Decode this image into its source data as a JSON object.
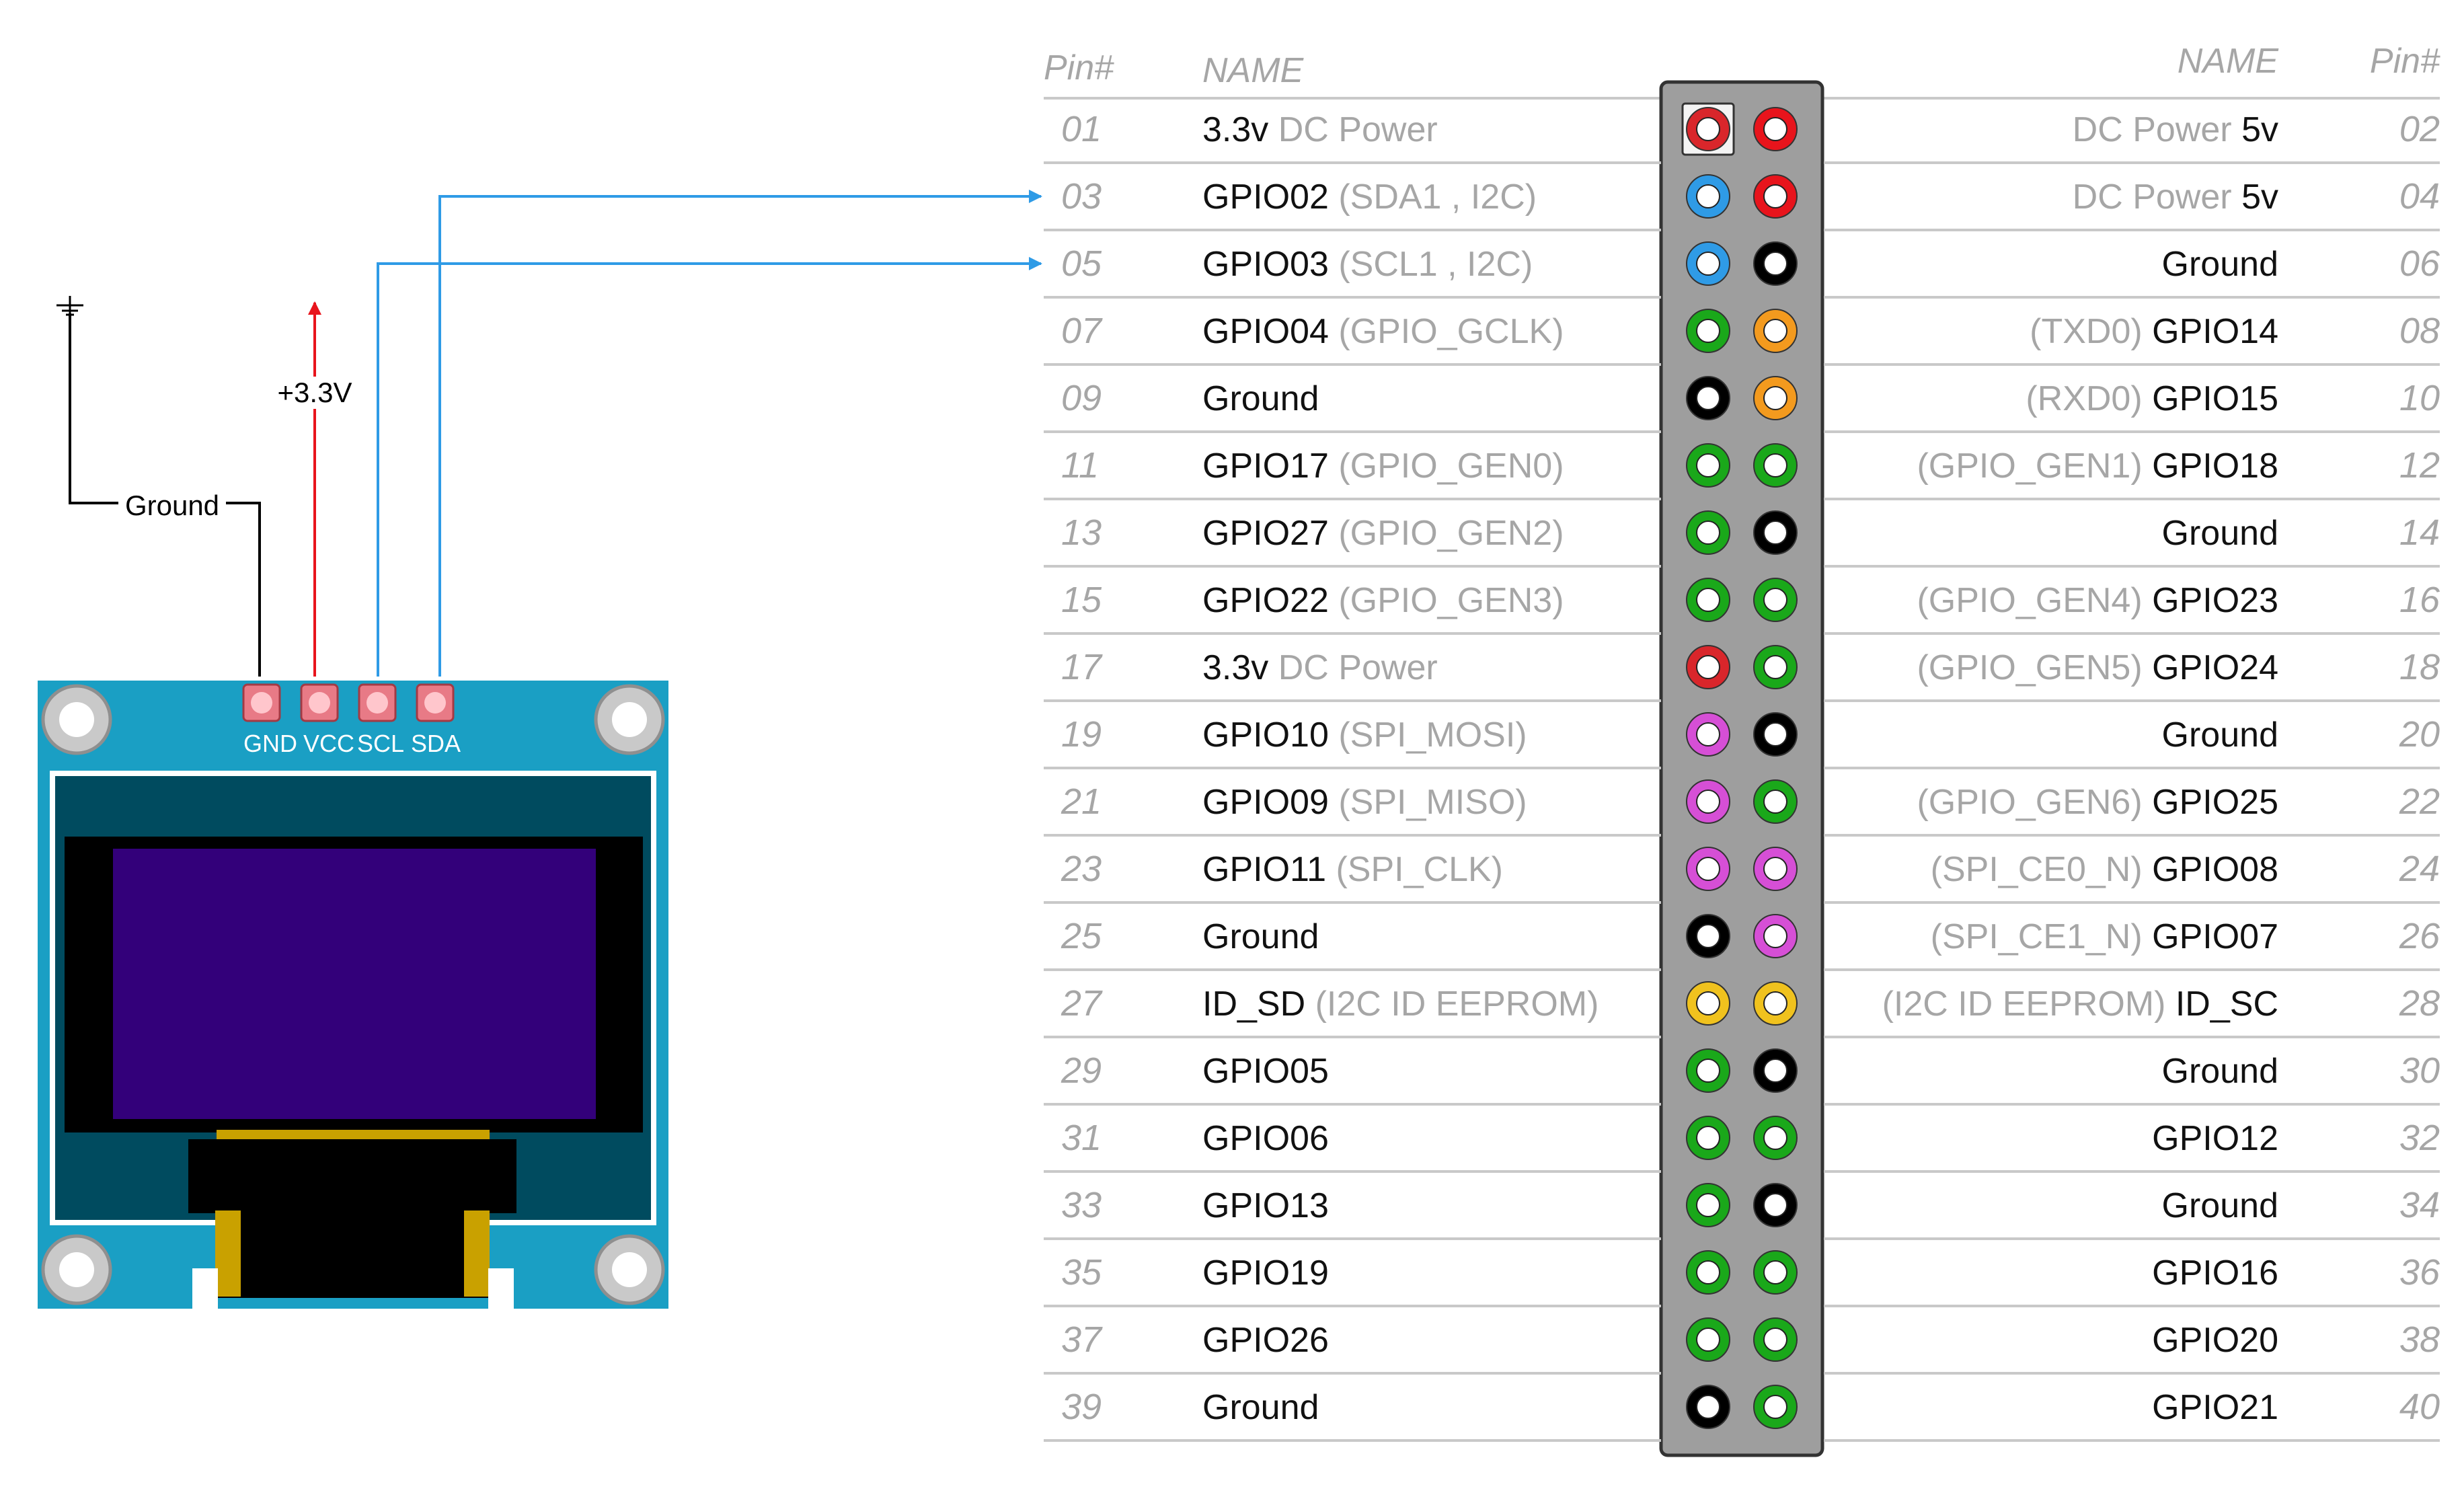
{
  "header": {
    "left_pin": "Pin#",
    "left_name": "NAME",
    "right_name": "NAME",
    "right_pin": "Pin#"
  },
  "colors": {
    "power_3v3": "#d9262b",
    "power_5v": "#e8141c",
    "i2c_blue": "#2f9be6",
    "gpio_green": "#1aa81a",
    "uart_orange": "#f39a1e",
    "spi_magenta": "#d64fd6",
    "eeprom_yellow": "#f0c21e",
    "ground_black": "#000000",
    "header_body": "#9e9e9e",
    "board": "#1a9fc4",
    "screen_frame": "#004b5f",
    "screen_active": "#33007a",
    "wire_sda_scl": "#2f9be6",
    "wire_vcc": "#e8141c",
    "wire_gnd": "#000000"
  },
  "rows": [
    {
      "lnum": "01",
      "lmain": "3.3v",
      "lsec": " DC Power",
      "lcolor": "power_3v3",
      "lsquare": true,
      "rcolor": "power_5v",
      "rsec": "DC Power ",
      "rmain": "5v",
      "rnum": "02"
    },
    {
      "lnum": "03",
      "lmain": "GPIO02",
      "lsec": " (SDA1 , I2C)",
      "lcolor": "i2c_blue",
      "rcolor": "power_5v",
      "rsec": "DC Power ",
      "rmain": "5v",
      "rnum": "04"
    },
    {
      "lnum": "05",
      "lmain": "GPIO03",
      "lsec": " (SCL1 , I2C)",
      "lcolor": "i2c_blue",
      "rcolor": "ground_black",
      "rsec": "",
      "rmain": "Ground",
      "rnum": "06"
    },
    {
      "lnum": "07",
      "lmain": "GPIO04",
      "lsec": " (GPIO_GCLK)",
      "lcolor": "gpio_green",
      "rcolor": "uart_orange",
      "rsec": "(TXD0) ",
      "rmain": "GPIO14",
      "rnum": "08"
    },
    {
      "lnum": "09",
      "lmain": "Ground",
      "lsec": "",
      "lcolor": "ground_black",
      "rcolor": "uart_orange",
      "rsec": "(RXD0) ",
      "rmain": "GPIO15",
      "rnum": "10"
    },
    {
      "lnum": "11",
      "lmain": "GPIO17",
      "lsec": " (GPIO_GEN0)",
      "lcolor": "gpio_green",
      "rcolor": "gpio_green",
      "rsec": "(GPIO_GEN1) ",
      "rmain": "GPIO18",
      "rnum": "12"
    },
    {
      "lnum": "13",
      "lmain": "GPIO27",
      "lsec": " (GPIO_GEN2)",
      "lcolor": "gpio_green",
      "rcolor": "ground_black",
      "rsec": "",
      "rmain": "Ground",
      "rnum": "14"
    },
    {
      "lnum": "15",
      "lmain": "GPIO22",
      "lsec": " (GPIO_GEN3)",
      "lcolor": "gpio_green",
      "rcolor": "gpio_green",
      "rsec": "(GPIO_GEN4) ",
      "rmain": "GPIO23",
      "rnum": "16"
    },
    {
      "lnum": "17",
      "lmain": "3.3v",
      "lsec": " DC Power",
      "lcolor": "power_3v3",
      "rcolor": "gpio_green",
      "rsec": "(GPIO_GEN5) ",
      "rmain": "GPIO24",
      "rnum": "18"
    },
    {
      "lnum": "19",
      "lmain": "GPIO10",
      "lsec": " (SPI_MOSI)",
      "lcolor": "spi_magenta",
      "rcolor": "ground_black",
      "rsec": "",
      "rmain": "Ground",
      "rnum": "20"
    },
    {
      "lnum": "21",
      "lmain": "GPIO09",
      "lsec": " (SPI_MISO)",
      "lcolor": "spi_magenta",
      "rcolor": "gpio_green",
      "rsec": "(GPIO_GEN6) ",
      "rmain": "GPIO25",
      "rnum": "22"
    },
    {
      "lnum": "23",
      "lmain": "GPIO11",
      "lsec": " (SPI_CLK)",
      "lcolor": "spi_magenta",
      "rcolor": "spi_magenta",
      "rsec": "(SPI_CE0_N) ",
      "rmain": "GPIO08",
      "rnum": "24"
    },
    {
      "lnum": "25",
      "lmain": "Ground",
      "lsec": "",
      "lcolor": "ground_black",
      "rcolor": "spi_magenta",
      "rsec": "(SPI_CE1_N) ",
      "rmain": "GPIO07",
      "rnum": "26"
    },
    {
      "lnum": "27",
      "lmain": "ID_SD",
      "lsec": " (I2C ID EEPROM)",
      "lcolor": "eeprom_yellow",
      "rcolor": "eeprom_yellow",
      "rsec": "(I2C ID EEPROM) ",
      "rmain": "ID_SC",
      "rnum": "28"
    },
    {
      "lnum": "29",
      "lmain": "GPIO05",
      "lsec": "",
      "lcolor": "gpio_green",
      "rcolor": "ground_black",
      "rsec": "",
      "rmain": "Ground",
      "rnum": "30"
    },
    {
      "lnum": "31",
      "lmain": "GPIO06",
      "lsec": "",
      "lcolor": "gpio_green",
      "rcolor": "gpio_green",
      "rsec": "",
      "rmain": "GPIO12",
      "rnum": "32"
    },
    {
      "lnum": "33",
      "lmain": "GPIO13",
      "lsec": "",
      "lcolor": "gpio_green",
      "rcolor": "ground_black",
      "rsec": "",
      "rmain": "Ground",
      "rnum": "34"
    },
    {
      "lnum": "35",
      "lmain": "GPIO19",
      "lsec": "",
      "lcolor": "gpio_green",
      "rcolor": "gpio_green",
      "rsec": "",
      "rmain": "GPIO16",
      "rnum": "36"
    },
    {
      "lnum": "37",
      "lmain": "GPIO26",
      "lsec": "",
      "lcolor": "gpio_green",
      "rcolor": "gpio_green",
      "rsec": "",
      "rmain": "GPIO20",
      "rnum": "38"
    },
    {
      "lnum": "39",
      "lmain": "Ground",
      "lsec": "",
      "lcolor": "ground_black",
      "rcolor": "gpio_green",
      "rsec": "",
      "rmain": "GPIO21",
      "rnum": "40"
    }
  ],
  "wiring": {
    "ground_label": "Ground",
    "vcc_label": "+3.3V"
  },
  "oled": {
    "pins": [
      "GND",
      "VCC",
      "SCL",
      "SDA"
    ]
  }
}
